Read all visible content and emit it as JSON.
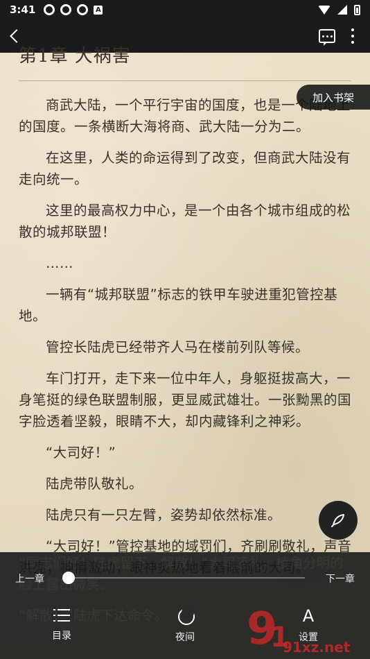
{
  "status_bar": {
    "time": "3:41",
    "a_icon": "A"
  },
  "reader": {
    "chapter_title": "第1章 大祸害",
    "add_to_shelf": "加入书架",
    "paragraphs": [
      "商武大陆，一个平行宇宙的国度，也是一个陆地上的国度。一条横断大海将商、武大陆一分为二。",
      "在这里，人类的命运得到了改变，但商武大陆没有走向统一。",
      "这里的最高权力中心，是一个由各个城市组成的松散的城邦联盟！",
      "……",
      "一辆有“城邦联盟”标志的铁甲车驶进重犯管控基地。",
      "管控长陆虎已经带齐人马在楼前列队等候。",
      "车门打开，走下来一位中年人，身躯挺拔高大，一身笔挺的绿色联盟制服，更显威武雄壮。一张黝黑的国字脸透着坚毅，眼睛不大，却内藏锋利之神彩。",
      "“大司好！”",
      "陆虎带队敬礼。",
      "陆虎只有一只左臂，姿势却依然标准。",
      "“大司好！”管控基地的域罚们，齐刷刷敬礼，声音洪亮，神情激动，眼神炙热地看着眼前的大司。",
      "“同志们好！陆虎留下，解散！”大司还礼，棱角分明的脸上露出微笑。",
      "“解散！”陆虎下达命令。"
    ]
  },
  "controls": {
    "prev_chapter": "上一章",
    "next_chapter": "下一章",
    "progress": 0.02,
    "tabs": [
      {
        "label": "目录",
        "icon": "list-icon"
      },
      {
        "label": "夜间",
        "icon": "moon-icon"
      },
      {
        "label": "设置",
        "icon": "font-icon",
        "glyph": "A"
      }
    ]
  },
  "watermark": {
    "text": "91xz.net"
  }
}
